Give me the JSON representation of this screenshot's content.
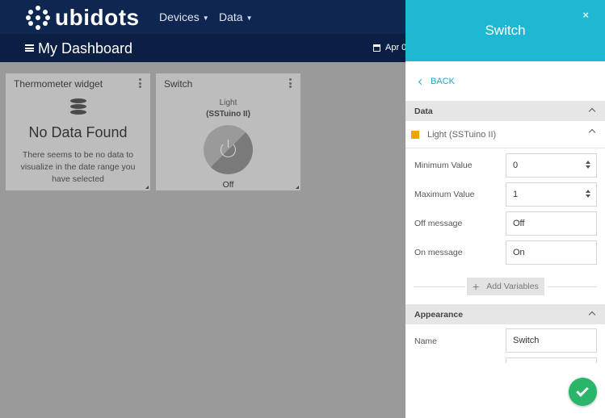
{
  "app": {
    "brand": "ubidots",
    "nav": [
      {
        "label": "Devices"
      },
      {
        "label": "Data"
      }
    ]
  },
  "dashboard": {
    "title": "My Dashboard",
    "date_label": "Apr 0"
  },
  "widgets": {
    "thermometer": {
      "title": "Thermometer widget",
      "empty_title": "No Data Found",
      "empty_message": "There seems to be no data to visualize in the date range you have selected"
    },
    "switch": {
      "title": "Switch",
      "variable_label": "Light",
      "device_label": "(SSTuino II)",
      "state": "Off"
    }
  },
  "panel": {
    "title": "Switch",
    "close_glyph": "×",
    "back_label": "BACK",
    "data_section": "Data",
    "variable": {
      "name": "Light (SSTuino II)",
      "color": "#f5a300"
    },
    "fields": {
      "min_label": "Minimum Value",
      "min_value": "0",
      "max_label": "Maximum Value",
      "max_value": "1",
      "off_label": "Off message",
      "off_value": "Off",
      "on_label": "On message",
      "on_value": "On"
    },
    "add_variables_label": "Add Variables",
    "appearance_section": "Appearance",
    "name_label": "Name",
    "name_value": "Switch"
  },
  "colors": {
    "topbar": "#0f2750",
    "panel_header": "#1fb8d2",
    "accent": "#1aa7c2",
    "save": "#29b56a"
  }
}
